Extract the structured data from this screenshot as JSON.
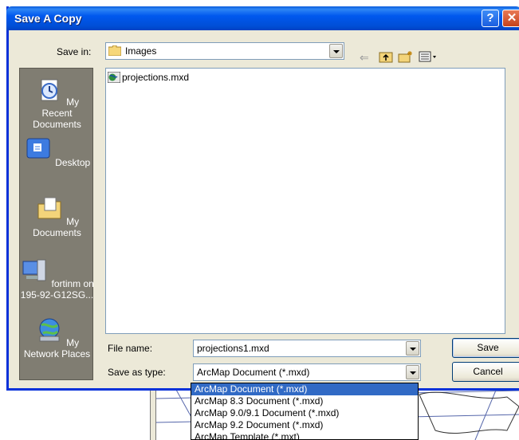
{
  "window": {
    "title": "Save A Copy"
  },
  "toolbar": {
    "save_in_label": "Save in:",
    "save_in_value": "Images",
    "back_icon": "back-arrow-icon",
    "up_icon": "up-folder-icon",
    "new_folder_icon": "new-folder-icon",
    "views_icon": "views-menu-icon"
  },
  "places": [
    {
      "label": "My Recent Documents",
      "icon": "recent-documents-icon"
    },
    {
      "label": "Desktop",
      "icon": "desktop-icon"
    },
    {
      "label": "My Documents",
      "icon": "my-documents-icon"
    },
    {
      "label": "fortinm on 195-92-G12SG...",
      "icon": "computer-icon"
    },
    {
      "label": "My Network Places",
      "icon": "network-places-icon"
    }
  ],
  "files": [
    {
      "name": "projections.mxd",
      "icon": "arcmap-document-icon"
    }
  ],
  "form": {
    "file_name_label": "File name:",
    "file_name_value": "projections1.mxd",
    "save_type_label": "Save as type:",
    "save_type_value": "ArcMap Document (*.mxd)",
    "save_label": "Save",
    "cancel_label": "Cancel"
  },
  "dropdown_options": [
    "ArcMap Document (*.mxd)",
    "ArcMap 8.3 Document (*.mxd)",
    "ArcMap 9.0/9.1 Document (*.mxd)",
    "ArcMap 9.2 Document (*.mxd)",
    "ArcMap Template (*.mxt)"
  ],
  "colors": {
    "titlebar": "#0058ee",
    "dialog_bg": "#ece9d8",
    "places_bg": "#807d72",
    "selection": "#316ac5"
  }
}
